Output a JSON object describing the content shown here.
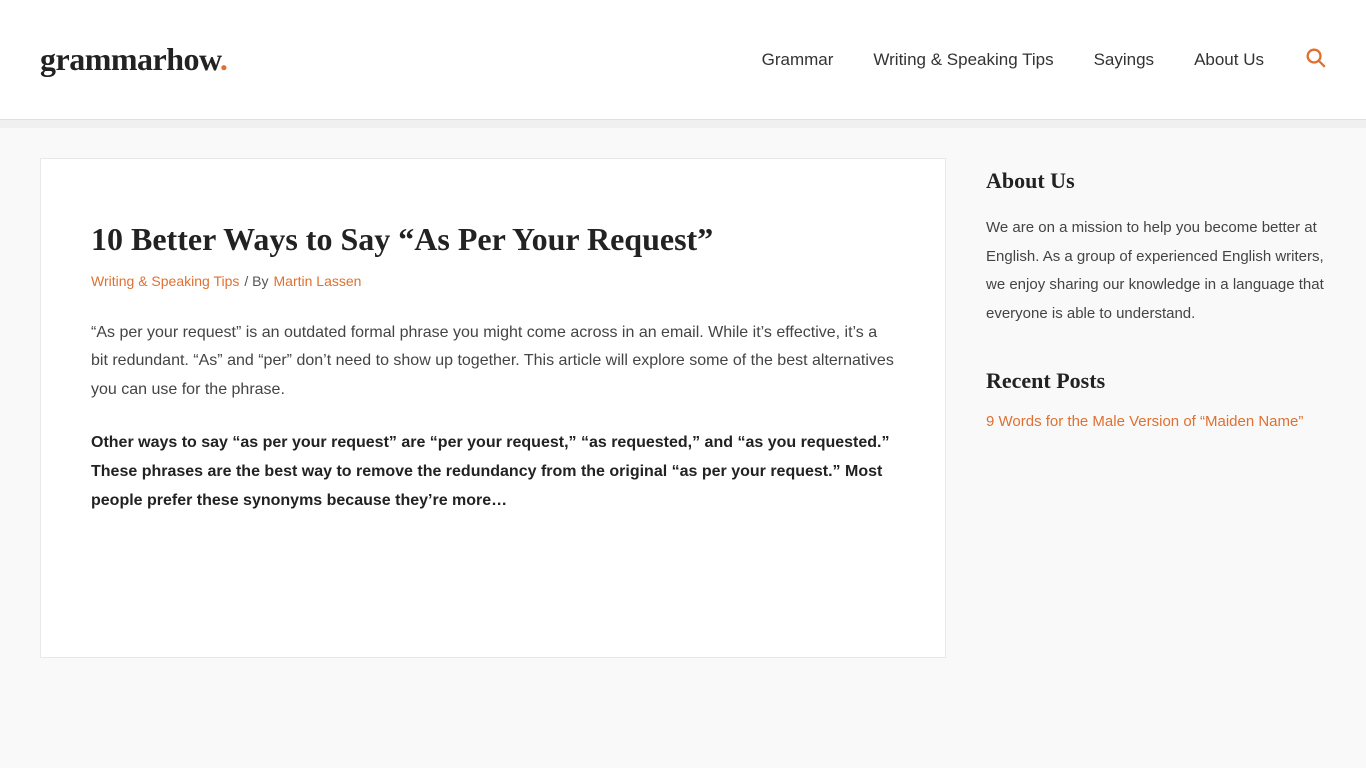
{
  "header": {
    "logo_text": "grammarhow",
    "logo_dot": ".",
    "nav": {
      "items": [
        {
          "label": "Grammar",
          "href": "#"
        },
        {
          "label": "Writing & Speaking Tips",
          "href": "#"
        },
        {
          "label": "Sayings",
          "href": "#"
        },
        {
          "label": "About Us",
          "href": "#"
        }
      ]
    },
    "search_icon": "🔍"
  },
  "subheader_line": "",
  "main": {
    "article": {
      "title": "10 Better Ways to Say “As Per Your Request”",
      "category": "Writing & Speaking Tips",
      "separator": "/ By",
      "author": "Martin Lassen",
      "intro": "“As per your request” is an outdated formal phrase you might come across in an email. While it’s effective, it’s a bit redundant. “As” and “per” don’t need to show up together. This article will explore some of the best alternatives you can use for the phrase.",
      "highlight": "Other ways to say “as per your request” are “per your request,” “as requested,” and “as you requested.” These phrases are the best way to remove the redundancy from the original “as per your request.” Most people prefer these synonyms because they’re more…"
    }
  },
  "sidebar": {
    "about": {
      "heading": "About Us",
      "text": "We are on a mission to help you become better at English. As a group of experienced English writers, we enjoy sharing our knowledge in a language that everyone is able to understand."
    },
    "recent_posts": {
      "heading": "Recent Posts",
      "items": [
        {
          "label": "9 Words for the Male Version of “Maiden Name”",
          "href": "#"
        }
      ]
    }
  }
}
